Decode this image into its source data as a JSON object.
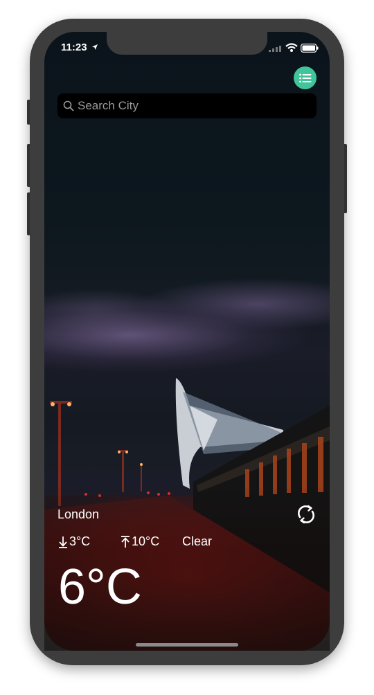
{
  "status_bar": {
    "time": "11:23"
  },
  "search": {
    "placeholder": "Search City"
  },
  "weather": {
    "city": "London",
    "min_temp": "3°C",
    "max_temp": "10°C",
    "condition": "Clear",
    "current_temp": "6°C"
  },
  "icons": {
    "location": "location-arrow-icon",
    "signal": "cellular-signal-icon",
    "wifi": "wifi-icon",
    "battery": "battery-icon",
    "list": "list-icon",
    "search": "search-icon",
    "refresh": "refresh-icon",
    "min": "arrow-down-icon",
    "max": "arrow-up-icon"
  },
  "colors": {
    "accent": "#41c49a",
    "search_bg": "#000000",
    "text": "#ffffff"
  }
}
